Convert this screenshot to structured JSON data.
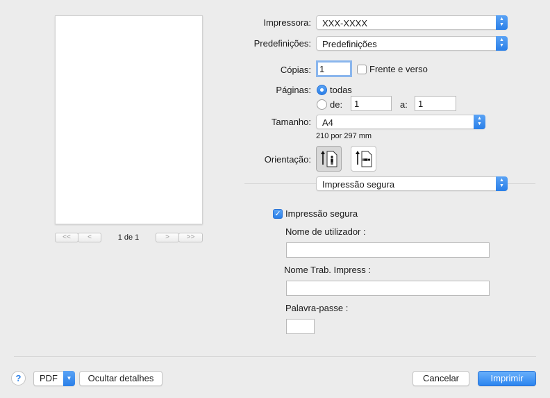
{
  "preview": {
    "page_count": "1 de 1",
    "first_symbol": "<<",
    "prev_symbol": "<",
    "next_symbol": ">",
    "last_symbol": ">>"
  },
  "printer": {
    "label": "Impressora:",
    "value": "XXX-XXXX"
  },
  "presets": {
    "label": "Predefinições:",
    "value": "Predefinições"
  },
  "copies": {
    "label": "Cópias:",
    "value": "1",
    "two_sided_label": "Frente e verso",
    "two_sided_checked": false
  },
  "pages": {
    "label": "Páginas:",
    "all_label": "todas",
    "range_label": "de:",
    "from": "1",
    "to_label": "a:",
    "to": "1",
    "selected": "all"
  },
  "paper_size": {
    "label": "Tamanho:",
    "value": "A4",
    "dimensions": "210 por 297 mm"
  },
  "orientation": {
    "label": "Orientação:",
    "selected": "portrait"
  },
  "section_popup": {
    "value": "Impressão segura"
  },
  "secure_print": {
    "checkbox_label": "Impressão segura",
    "checked": true,
    "username_label": "Nome de utilizador :",
    "username": "",
    "job_name_label": "Nome Trab. Impress :",
    "job_name": "",
    "password_label": "Palavra-passe :",
    "password": ""
  },
  "footer": {
    "help_symbol": "?",
    "pdf_label": "PDF",
    "hide_details_label": "Ocultar detalhes",
    "cancel_label": "Cancelar",
    "print_label": "Imprimir"
  },
  "colors": {
    "accent": "#2a7fe8",
    "background": "#ececec"
  }
}
